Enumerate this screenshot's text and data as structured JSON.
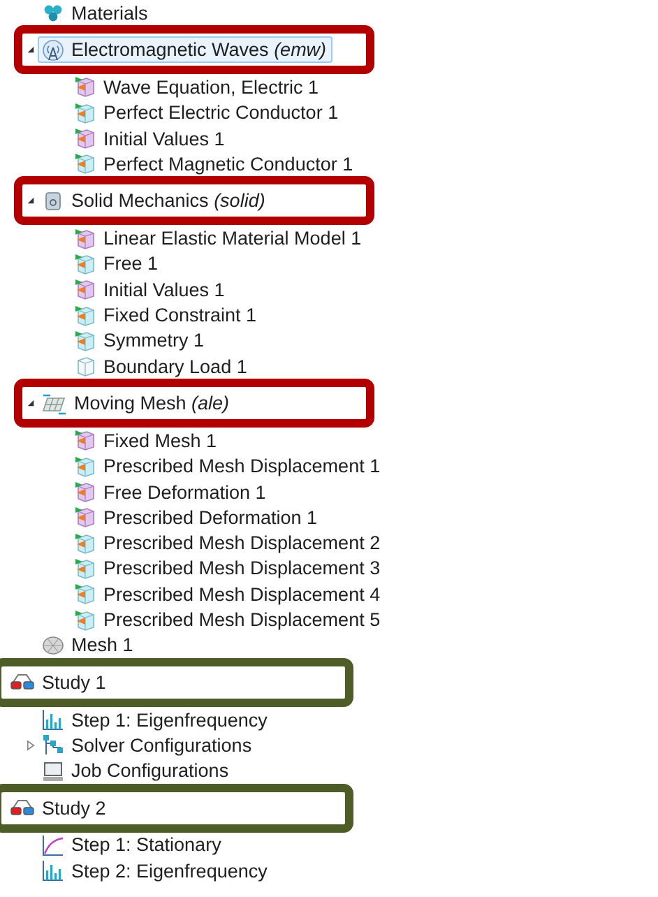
{
  "tree": {
    "component_children": [
      {
        "label": "Materials",
        "kind": "materials",
        "selected": false
      },
      {
        "label": "Electromagnetic Waves *(emw)*",
        "kind": "emw",
        "selected": true,
        "expanded": true,
        "highlight": {
          "color": "#b20000"
        },
        "children": [
          {
            "label": "Wave Equation, Electric 1",
            "kind": "domain",
            "selected": false
          },
          {
            "label": "Perfect Electric Conductor 1",
            "kind": "boundary",
            "selected": false
          },
          {
            "label": "Initial Values 1",
            "kind": "domain",
            "selected": false
          },
          {
            "label": "Perfect Magnetic Conductor 1",
            "kind": "boundary",
            "selected": false
          }
        ]
      },
      {
        "label": "Solid Mechanics *(solid)*",
        "kind": "solid",
        "selected": false,
        "expanded": true,
        "highlight": {
          "color": "#b20000"
        },
        "children": [
          {
            "label": "Linear Elastic Material Model 1",
            "kind": "domain",
            "selected": false
          },
          {
            "label": "Free 1",
            "kind": "boundary",
            "selected": false
          },
          {
            "label": "Initial Values 1",
            "kind": "domain",
            "selected": false
          },
          {
            "label": "Fixed Constraint 1",
            "kind": "boundary",
            "selected": false
          },
          {
            "label": "Symmetry 1",
            "kind": "boundary",
            "selected": false
          },
          {
            "label": "Boundary Load 1",
            "kind": "plain",
            "selected": false
          }
        ]
      },
      {
        "label": "Moving Mesh *(ale)*",
        "kind": "ale",
        "selected": false,
        "expanded": true,
        "highlight": {
          "color": "#b20000"
        },
        "children": [
          {
            "label": "Fixed Mesh 1",
            "kind": "domain",
            "selected": false
          },
          {
            "label": "Prescribed Mesh Displacement 1",
            "kind": "boundary",
            "selected": false
          },
          {
            "label": "Free Deformation 1",
            "kind": "domain",
            "selected": false
          },
          {
            "label": "Prescribed Deformation 1",
            "kind": "domain",
            "selected": false
          },
          {
            "label": "Prescribed Mesh Displacement 2",
            "kind": "boundary",
            "selected": false
          },
          {
            "label": "Prescribed Mesh Displacement 3",
            "kind": "boundary",
            "selected": false
          },
          {
            "label": "Prescribed Mesh Displacement 4",
            "kind": "boundary",
            "selected": false
          },
          {
            "label": "Prescribed Mesh Displacement 5",
            "kind": "boundary",
            "selected": false
          }
        ]
      },
      {
        "label": "Mesh 1",
        "kind": "mesh",
        "selected": false
      }
    ],
    "studies": [
      {
        "label": "Study 1",
        "kind": "study",
        "selected": false,
        "highlight": {
          "color": "#4e5d27"
        },
        "children": [
          {
            "label": "Step 1: Eigenfrequency",
            "kind": "eigen",
            "selected": false
          },
          {
            "label": "Solver Configurations",
            "kind": "solver",
            "selected": false,
            "expanded": false
          },
          {
            "label": "Job Configurations",
            "kind": "job",
            "selected": false
          }
        ]
      },
      {
        "label": "Study 2",
        "kind": "study",
        "selected": false,
        "highlight": {
          "color": "#4e5d27"
        },
        "children": [
          {
            "label": "Step 1: Stationary",
            "kind": "stationary",
            "selected": false
          },
          {
            "label": "Step 2: Eigenfrequency",
            "kind": "eigen",
            "selected": false
          }
        ]
      }
    ]
  }
}
